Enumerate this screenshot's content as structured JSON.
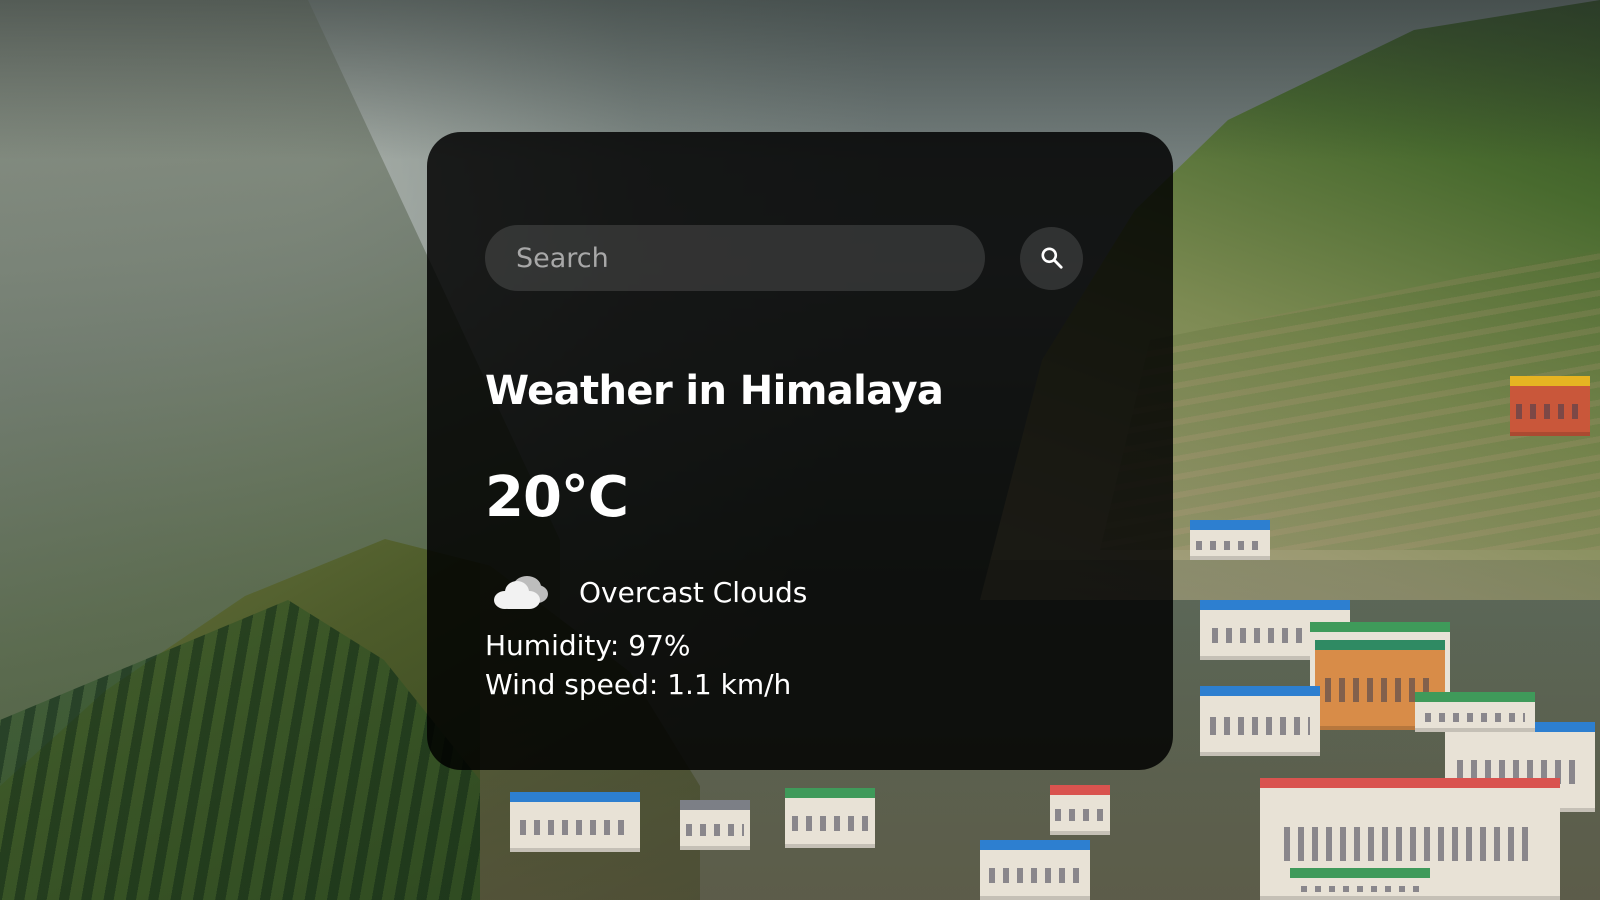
{
  "search": {
    "placeholder": "Search",
    "value": "",
    "button_icon": "search-icon"
  },
  "weather": {
    "title": "Weather in Himalaya",
    "temperature": "20°C",
    "condition_icon": "cloud-icon",
    "condition": "Overcast Clouds",
    "humidity": "Humidity: 97%",
    "wind": "Wind speed: 1.1 km/h"
  },
  "colors": {
    "card_background": "#000000",
    "text": "#ffffff",
    "input_background": "#4a4a4a",
    "placeholder": "#a8a8a8"
  }
}
